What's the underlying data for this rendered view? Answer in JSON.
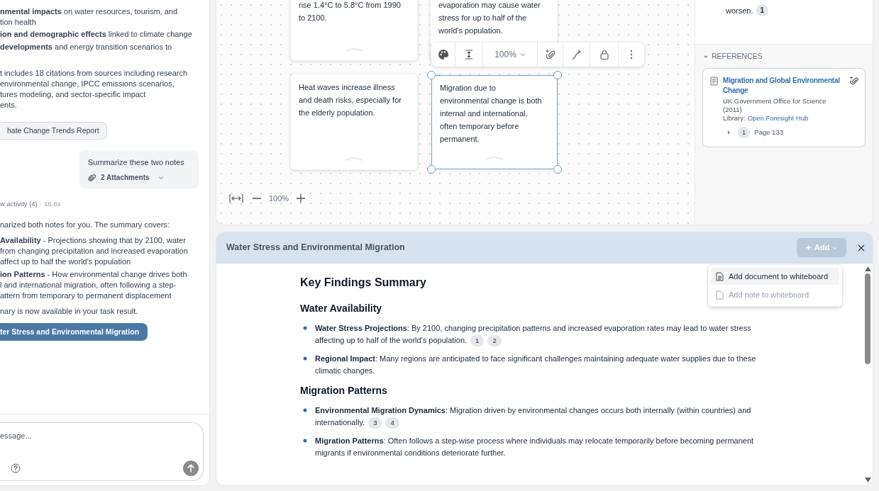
{
  "chat": {
    "items": [
      {
        "kind": "bullet",
        "lines": [
          "**nmental impacts** on water resources, tourism, and",
          "tion health"
        ]
      },
      {
        "kind": "bullet",
        "lines": [
          "**ion and demographic effects** linked to climate change"
        ]
      },
      {
        "kind": "bullet",
        "lines": [
          "**developments** and energy transition scenarios to"
        ]
      },
      {
        "kind": "paragraph",
        "lines": [
          "t includes 18 citations from sources including research",
          "environmental change, IPCC emissions scenarios,",
          "tures modeling, and sector-specific impact",
          "ents."
        ]
      },
      {
        "kind": "chip",
        "label": "hate Change Trends Report"
      },
      {
        "kind": "user_message",
        "text": "Summarize these two notes",
        "attachments": "2 Attachments"
      },
      {
        "kind": "activity",
        "label": "w activity (4)",
        "separator": "·",
        "duration": "16.8s"
      },
      {
        "kind": "paragraph",
        "lines": [
          "narized both notes for you. The summary covers:"
        ]
      },
      {
        "kind": "bullet",
        "lines": [
          "**Availability** - Projections showing that by 2100, water",
          "from changing precipitation and increased evaporation",
          "affect up to half the world's population"
        ]
      },
      {
        "kind": "bullet",
        "lines": [
          "**ion Patterns** - How environmental change drives both",
          "l and international migration, often following a step-",
          "attern from temporary to permanent displacement"
        ]
      },
      {
        "kind": "paragraph",
        "lines": [
          "nary is now available in your task result."
        ]
      },
      {
        "kind": "document_button",
        "label": "ter Stress and Environmental Migration"
      }
    ],
    "input": {
      "placeholder": "essage..."
    }
  },
  "whiteboard": {
    "notes": [
      {
        "text": "rise 1.4°C to 5.8°C from 1990 to 2100.",
        "selected": false
      },
      {
        "text": "evaporation may cause water stress for up to half of the world's population.",
        "selected": false
      },
      {
        "text": "Heat waves increase illness and death risks, especially for the elderly population.",
        "selected": false
      },
      {
        "text": "Migration due to environmental change is both internal and international, often temporary before permanent.",
        "selected": true
      }
    ],
    "toolbar": {
      "zoom": "100%"
    },
    "zoom": "100%"
  },
  "details": {
    "text": "worsen.",
    "citation": "1",
    "references": {
      "title": "REFERENCES",
      "expanded": true,
      "items": [
        {
          "title": "Migration and Global Environmental Change",
          "source": "UK Government Office for Science (2011)",
          "library_label": "Library:",
          "library": "Open Foresight Hub",
          "citation": "1",
          "page": "Page 133"
        }
      ]
    }
  },
  "document": {
    "title": "Water Stress and Environmental Migration",
    "add_button": "Add",
    "menu": [
      {
        "label": "Add document to whiteboard",
        "highlighted": true,
        "disabled": false
      },
      {
        "label": "Add note to whiteboard",
        "highlighted": false,
        "disabled": true
      }
    ],
    "heading": "Key Findings Summary",
    "sections": [
      {
        "heading": "Water Availability",
        "items": [
          {
            "text": "**Water Stress Projections**: By 2100, changing precipitation patterns and increased evaporation rates may lead to water stress affecting up to half of the world's population.",
            "citations": [
              "1",
              "2"
            ]
          },
          {
            "text": "**Regional Impact**: Many regions are anticipated to face significant challenges maintaining adequate water supplies due to these climatic changes."
          }
        ]
      },
      {
        "heading": "Migration Patterns",
        "items": [
          {
            "text": "**Environmental Migration Dynamics**: Migration driven by environmental changes occurs both internally (within countries) and internationally.",
            "citations": [
              "3",
              "4"
            ]
          },
          {
            "text": "**Migration Patterns**: Often follows a step-wise process where individuals may relocate temporarily before becoming permanent migrants if environmental conditions deteriorate further."
          }
        ]
      }
    ]
  }
}
